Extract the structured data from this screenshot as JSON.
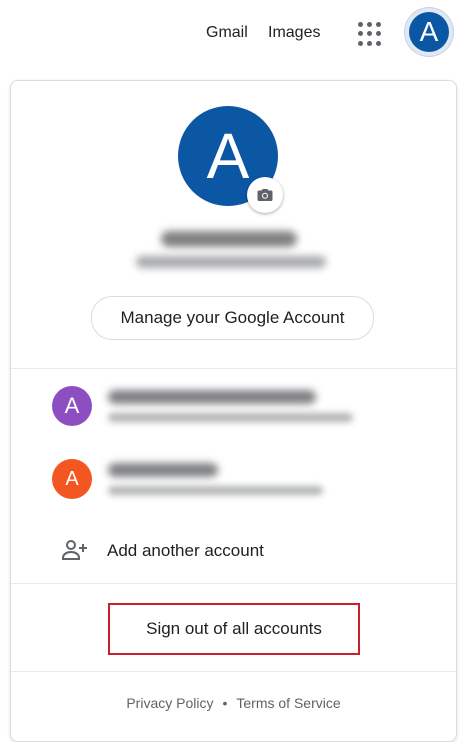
{
  "topbar": {
    "gmail_label": "Gmail",
    "images_label": "Images",
    "apps_icon": "apps-grid-icon",
    "avatar_letter": "A"
  },
  "profile": {
    "avatar_letter": "A",
    "camera_icon": "camera-icon",
    "manage_label": "Manage your Google Account"
  },
  "accounts": [
    {
      "avatar_letter": "A",
      "color": "#8c4ec0"
    },
    {
      "avatar_letter": "A",
      "color": "#f35621"
    }
  ],
  "add_account": {
    "icon": "person-add-icon",
    "label": "Add another account"
  },
  "signout": {
    "label": "Sign out of all accounts",
    "highlight_color": "#c8202b"
  },
  "footer": {
    "privacy": "Privacy Policy",
    "separator": "•",
    "terms": "Terms of Service"
  },
  "colors": {
    "accent_blue": "#0b57a4",
    "divider": "#e8eaed"
  }
}
